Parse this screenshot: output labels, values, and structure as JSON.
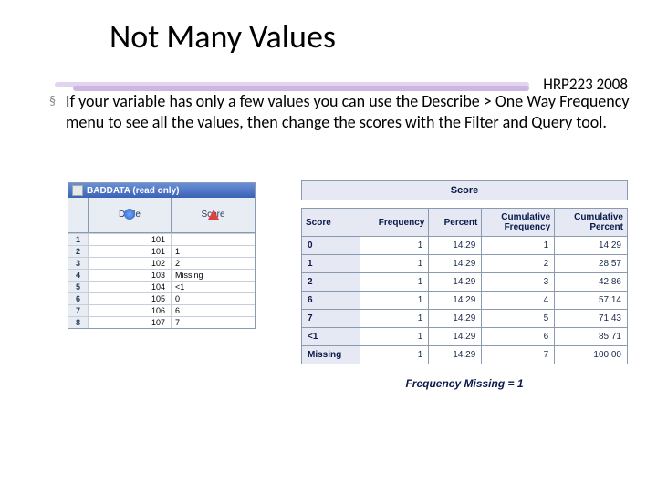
{
  "title": "Not Many Values",
  "course": "HRP223 2008",
  "bullet": "If your variable has only a few values you can use the Describe > One Way Frequency menu to see all the values, then change the scores with the Filter and Query tool.",
  "viewer": {
    "title": "BADDATA (read only)",
    "cols": {
      "dude": "Dude",
      "score": "Score"
    },
    "rows": [
      {
        "n": "1",
        "dude": "101",
        "score": ""
      },
      {
        "n": "2",
        "dude": "101",
        "score": "1"
      },
      {
        "n": "3",
        "dude": "102",
        "score": "2"
      },
      {
        "n": "4",
        "dude": "103",
        "score": "Missing"
      },
      {
        "n": "5",
        "dude": "104",
        "score": "<1"
      },
      {
        "n": "6",
        "dude": "105",
        "score": "0"
      },
      {
        "n": "7",
        "dude": "106",
        "score": "6"
      },
      {
        "n": "8",
        "dude": "107",
        "score": "7"
      }
    ]
  },
  "freq": {
    "title": "Score",
    "headers": [
      "Score",
      "Frequency",
      "Percent",
      "Cumulative Frequency",
      "Cumulative Percent"
    ],
    "rows": [
      [
        "0",
        "1",
        "14.29",
        "1",
        "14.29"
      ],
      [
        "1",
        "1",
        "14.29",
        "2",
        "28.57"
      ],
      [
        "2",
        "1",
        "14.29",
        "3",
        "42.86"
      ],
      [
        "6",
        "1",
        "14.29",
        "4",
        "57.14"
      ],
      [
        "7",
        "1",
        "14.29",
        "5",
        "71.43"
      ],
      [
        "<1",
        "1",
        "14.29",
        "6",
        "85.71"
      ],
      [
        "Missing",
        "1",
        "14.29",
        "7",
        "100.00"
      ]
    ],
    "missing": "Frequency Missing = 1"
  },
  "chart_data": {
    "type": "table",
    "title": "Score",
    "columns": [
      "Score",
      "Frequency",
      "Percent",
      "Cumulative Frequency",
      "Cumulative Percent"
    ],
    "rows": [
      [
        "0",
        1,
        14.29,
        1,
        14.29
      ],
      [
        "1",
        1,
        14.29,
        2,
        28.57
      ],
      [
        "2",
        1,
        14.29,
        3,
        42.86
      ],
      [
        "6",
        1,
        14.29,
        4,
        57.14
      ],
      [
        "7",
        1,
        14.29,
        5,
        71.43
      ],
      [
        "<1",
        1,
        14.29,
        6,
        85.71
      ],
      [
        "Missing",
        1,
        14.29,
        7,
        100.0
      ]
    ],
    "note": "Frequency Missing = 1"
  }
}
